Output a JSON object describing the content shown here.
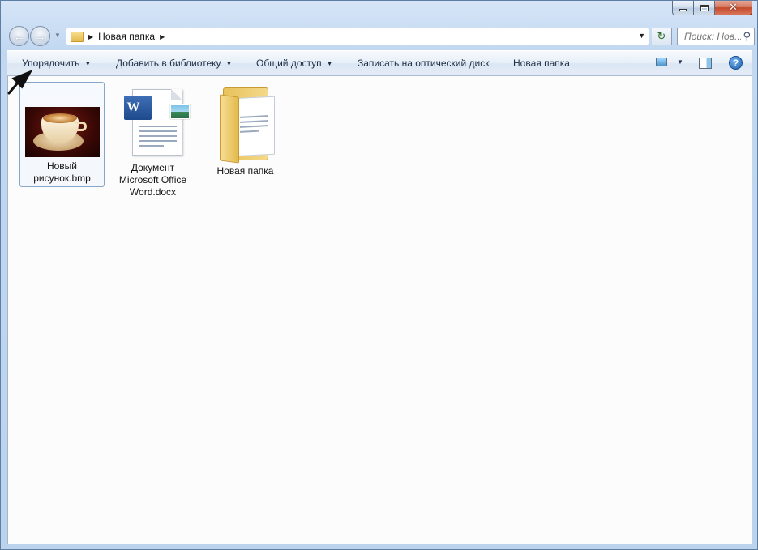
{
  "window": {
    "caption": {
      "close_glyph": "✕"
    }
  },
  "nav": {
    "back_glyph": "←",
    "forward_glyph": "→",
    "history_glyph": "▼",
    "address_crumb": "Новая папка",
    "crumb_separator": "▶",
    "address_dropdown": "▼",
    "refresh_glyph": "↻",
    "search_placeholder": "Поиск: Нов...",
    "search_icon_glyph": "⚲"
  },
  "toolbar": {
    "items": [
      {
        "label": "Упорядочить",
        "has_dropdown": true
      },
      {
        "label": "Добавить в библиотеку",
        "has_dropdown": true
      },
      {
        "label": "Общий доступ",
        "has_dropdown": true
      },
      {
        "label": "Записать на оптический диск",
        "has_dropdown": false
      },
      {
        "label": "Новая папка",
        "has_dropdown": false
      }
    ],
    "dropdown_glyph": "▼",
    "help_glyph": "?"
  },
  "files": [
    {
      "label": "Новый рисунок.bmp",
      "type": "bmp-image",
      "selected": true
    },
    {
      "label": "Документ Microsoft Office Word.docx",
      "type": "word-document",
      "selected": false
    },
    {
      "label": "Новая папка",
      "type": "folder",
      "selected": false
    }
  ],
  "colors": {
    "window_frame": "#c2d8f1",
    "content_bg": "#fcfcfd",
    "selection_border": "#88a6c8",
    "close_button": "#c4492b"
  }
}
